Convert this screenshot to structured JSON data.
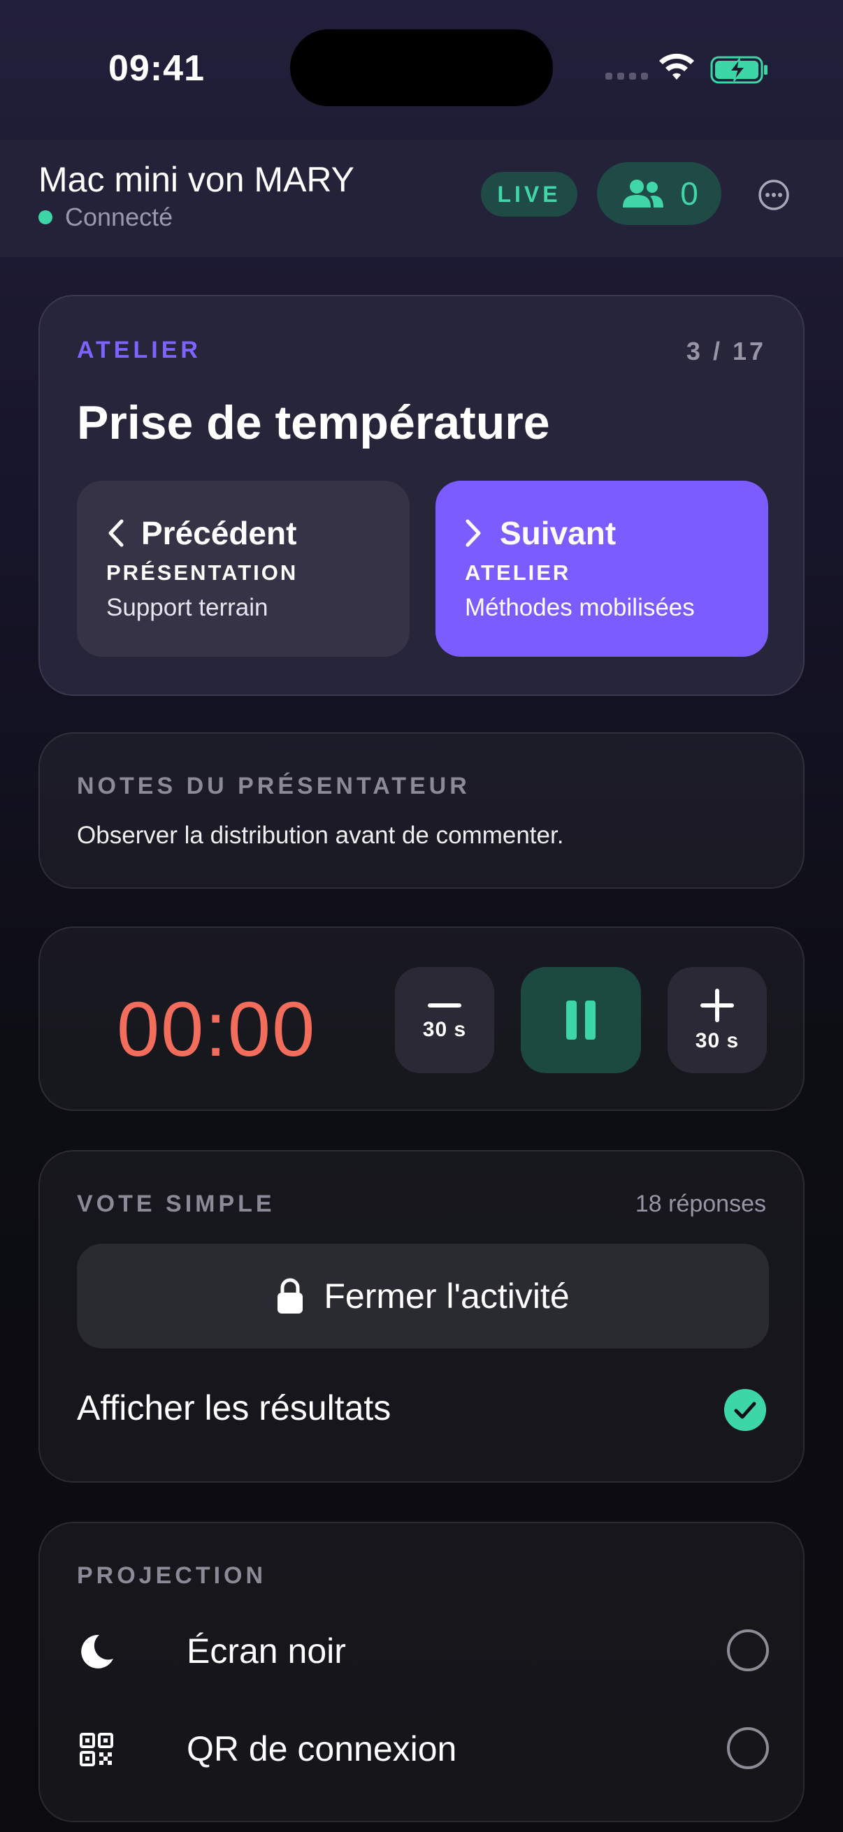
{
  "status_bar": {
    "time": "09:41",
    "wifi_icon": "wifi-icon",
    "battery_icon": "battery-charging-icon",
    "battery_color": "#3dd6a6"
  },
  "header": {
    "device_name": "Mac mini von MARY",
    "connection_status": "Connecté",
    "status_color": "#3dd6a6",
    "live_badge": "LIVE",
    "participants_icon": "people-icon",
    "participants_count": "0",
    "more_icon": "more-icon"
  },
  "atelier": {
    "kind": "ATELIER",
    "position": "3 / 17",
    "title": "Prise de température",
    "previous": {
      "icon": "chevron-left-icon",
      "label": "Précédent",
      "kind": "PRÉSENTATION",
      "title": "Support terrain"
    },
    "next": {
      "icon": "chevron-right-icon",
      "label": "Suivant",
      "kind": "ATELIER",
      "title": "Méthodes mobilisées"
    },
    "accent_color": "#7b5cff"
  },
  "notes": {
    "label": "NOTES DU PRÉSENTATEUR",
    "text": "Observer la distribution avant de commenter."
  },
  "timer": {
    "value": "00:00",
    "value_color": "#f26d5b",
    "minus_label": "30 s",
    "plus_label": "30 s",
    "pause_icon": "pause-icon",
    "minus_icon": "minus-icon",
    "plus_icon": "plus-icon"
  },
  "vote": {
    "label": "VOTE SIMPLE",
    "responses": "18 réponses",
    "close_icon": "lock-icon",
    "close_label": "Fermer l'activité",
    "show_results_label": "Afficher les résultats",
    "show_results_checked": true
  },
  "projection": {
    "label": "PROJECTION",
    "options": [
      {
        "icon": "moon-icon",
        "label": "Écran noir",
        "selected": false
      },
      {
        "icon": "qr-code-icon",
        "label": "QR de connexion",
        "selected": false
      }
    ]
  }
}
